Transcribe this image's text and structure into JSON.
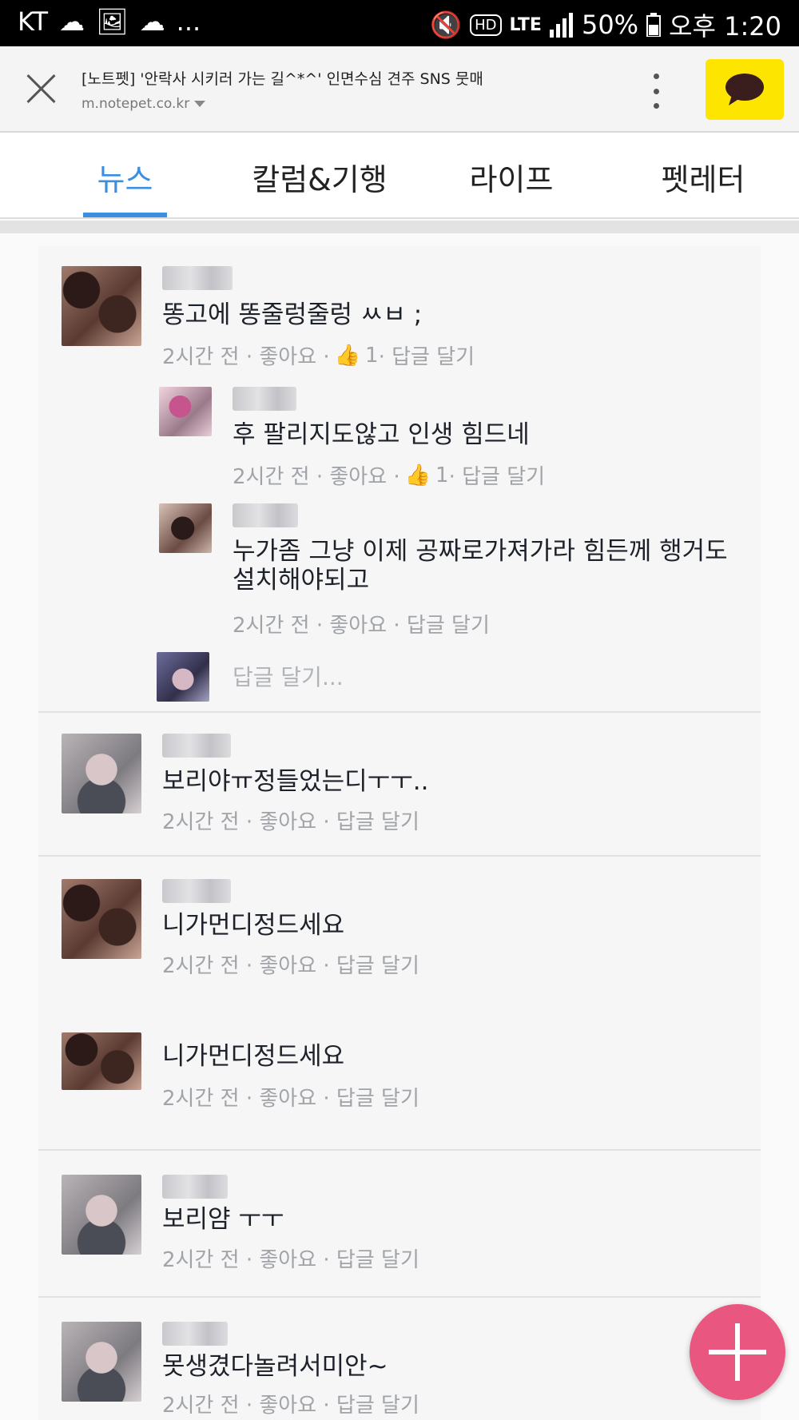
{
  "status_bar": {
    "carrier": "KT",
    "more": "...",
    "network": "LTE",
    "battery": "50%",
    "time": "오후 1:20"
  },
  "browser": {
    "page_title": "[노트펫] '안락사 시키러 가는 길^*^' 인면수심 견주 SNS 뭇매",
    "url": "m.notepet.co.kr"
  },
  "tabs": [
    {
      "label": "뉴스",
      "active": true
    },
    {
      "label": "칼럼&기행",
      "active": false
    },
    {
      "label": "라이프",
      "active": false
    },
    {
      "label": "펫레터",
      "active": false
    }
  ],
  "comments": [
    {
      "text": "똥고에 똥줄렁줄렁 ㅆㅂ ;",
      "meta_pre": "2시간 전 · 좋아요 · ",
      "likes": "1",
      "meta_post": " · 답글 달기"
    },
    {
      "text": "후 팔리지도않고 인생 힘드네",
      "meta_pre": "2시간 전 · 좋아요 · ",
      "likes": "1",
      "meta_post": " · 답글 달기"
    },
    {
      "text_line1": "누가좀 그냥 이제 공짜로가져가라 힘든께 행거도",
      "text_line2": "설치해야되고",
      "meta": "2시간 전 · 좋아요 · 답글 달기"
    },
    {
      "placeholder": "답글 달기..."
    },
    {
      "text": "보리야ㅠ정들었는디ㅜㅜ..",
      "meta": "2시간 전 · 좋아요 · 답글 달기"
    },
    {
      "text": "니가먼디정드세요",
      "meta": "2시간 전 · 좋아요 · 답글 달기"
    },
    {
      "text": "니가먼디정드세요",
      "meta": "2시간 전 · 좋아요 · 답글 달기"
    },
    {
      "text": "보리얌 ㅜㅜ",
      "meta": "2시간 전 · 좋아요 · 답글 달기"
    },
    {
      "text": "못생겼다놀려서미안~",
      "meta": "2시간 전 · 좋아요 · 답글 달기"
    }
  ],
  "colors": {
    "accent": "#3b8fe0",
    "fab": "#e95780",
    "kakao": "#fee500"
  },
  "icons": [
    "close-icon",
    "more-vert-icon",
    "kakao-talk-icon",
    "thumbs-up-icon",
    "add-icon"
  ]
}
